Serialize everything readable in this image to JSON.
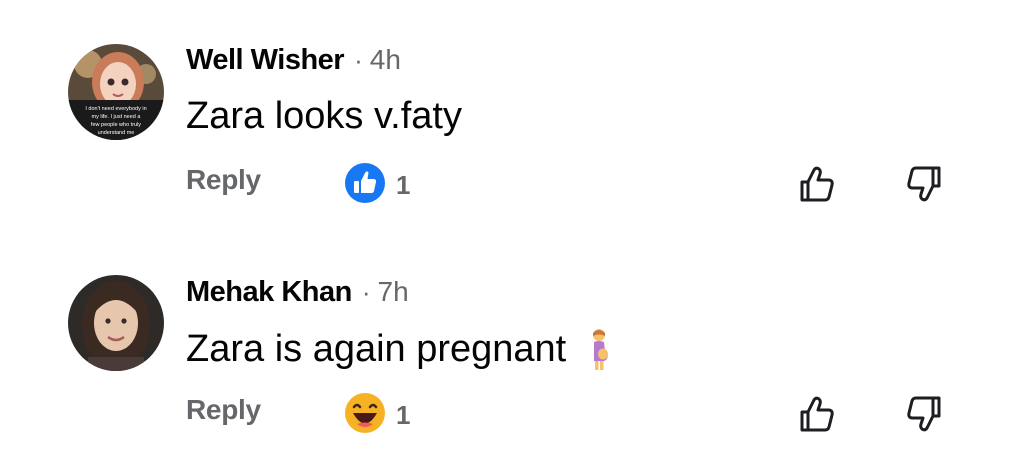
{
  "comments": [
    {
      "author": "Well Wisher",
      "separator": "·",
      "time": "4h",
      "text": "Zara looks v.faty",
      "reply_label": "Reply",
      "reaction_icon": "like-icon",
      "reaction_color": "#1877f2",
      "reaction_count": "1",
      "avatar_caption": [
        "I don't need everybody in",
        "my life. I just need a",
        "few people who truly",
        "understand me"
      ]
    },
    {
      "author": "Mehak Khan",
      "separator": "·",
      "time": "7h",
      "text": "Zara is again pregnant",
      "text_emoji": "pregnant-woman-emoji",
      "reply_label": "Reply",
      "reaction_icon": "haha-icon",
      "reaction_color": "#f7b125",
      "reaction_count": "1"
    }
  ]
}
